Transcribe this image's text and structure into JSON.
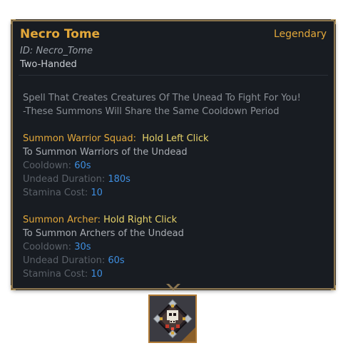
{
  "item": {
    "name": "Necro Tome",
    "rarity": "Legendary",
    "id_line": "ID: Necro_Tome",
    "type": "Two-Handed"
  },
  "description": {
    "line1": "Spell That Creates Creatures Of The Unead To Fight For You!",
    "line2": "-These Summons Will Share the Same Cooldown Period"
  },
  "abilities": [
    {
      "name": "Summon Warrior Squad:",
      "input": "Hold Left Click",
      "effect": "To Summon Warriors of the Undead",
      "stats": [
        {
          "label": "Cooldown:",
          "value": "60s"
        },
        {
          "label": "Undead Duration:",
          "value": "180s"
        },
        {
          "label": "Stamina Cost:",
          "value": "10"
        }
      ]
    },
    {
      "name": "Summon Archer:",
      "input": "Hold Right Click",
      "effect": "To Summon Archers of the Undead",
      "stats": [
        {
          "label": "Cooldown:",
          "value": "30s"
        },
        {
          "label": "Undead Duration:",
          "value": "60s"
        },
        {
          "label": "Stamina Cost:",
          "value": "10"
        }
      ]
    }
  ],
  "icon": "necro-tome-book-icon",
  "colors": {
    "title": "#e3a83a",
    "input": "#e8d46a",
    "value": "#3e8ee0",
    "panel": "#181c22",
    "border": "#8a7550"
  }
}
